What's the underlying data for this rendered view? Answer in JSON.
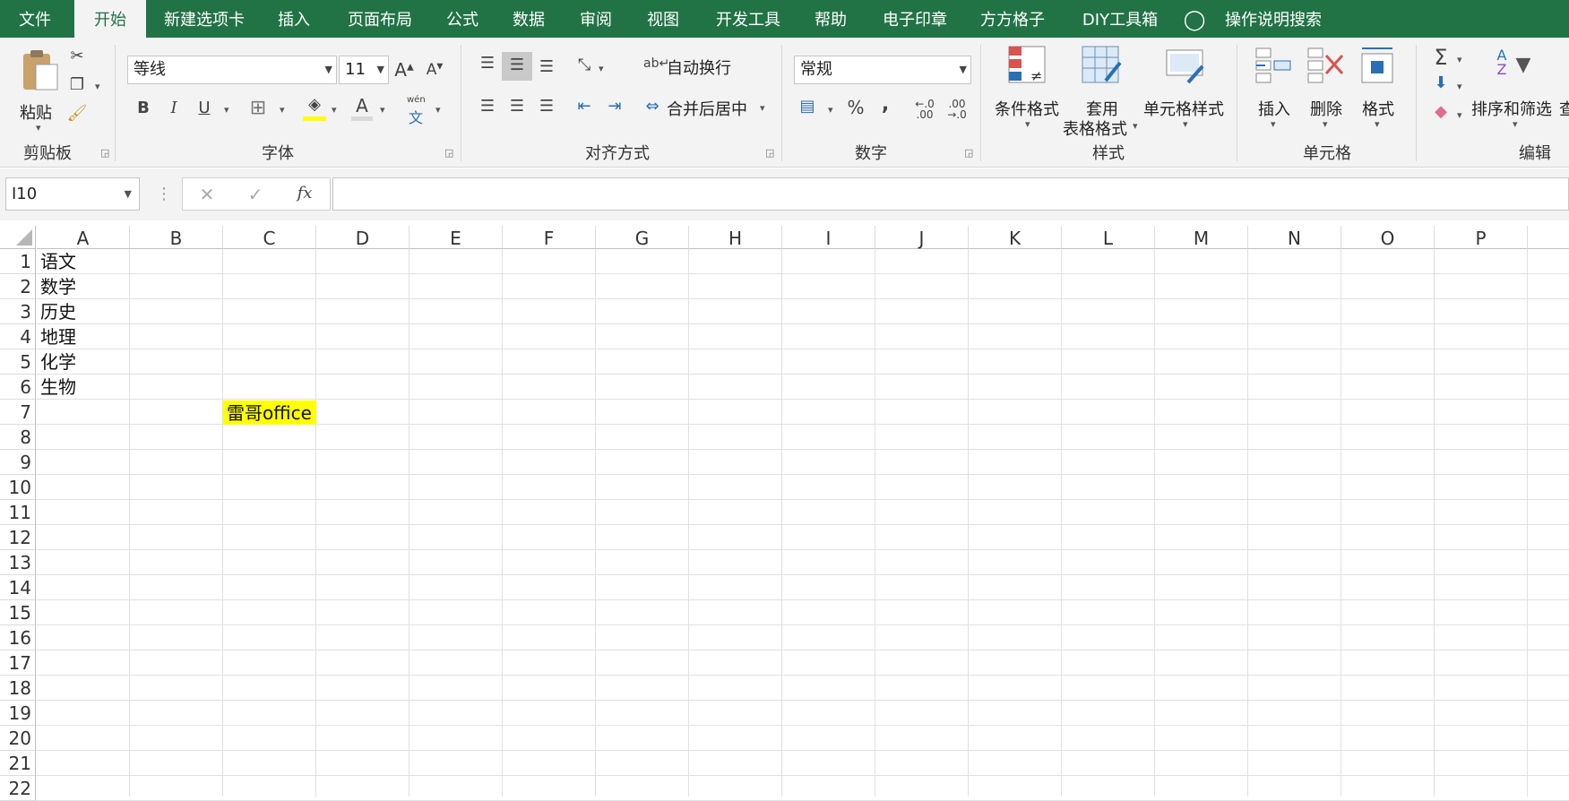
{
  "ribbon_tabs": [
    "文件",
    "开始",
    "新建选项卡",
    "插入",
    "页面布局",
    "公式",
    "数据",
    "审阅",
    "视图",
    "开发工具",
    "帮助",
    "电子印章",
    "方方格子",
    "DIY工具箱"
  ],
  "active_tab": "开始",
  "tell_me": "操作说明搜索",
  "clipboard": {
    "paste": "粘贴",
    "group": "剪贴板"
  },
  "font": {
    "name": "等线",
    "size": "11",
    "bold": "B",
    "italic": "I",
    "underline": "U",
    "phonetic_top": "wén",
    "phonetic_bottom": "文",
    "group": "字体"
  },
  "alignment": {
    "wrap": "自动换行",
    "merge": "合并后居中",
    "group": "对齐方式"
  },
  "number": {
    "format": "常规",
    "percent": "%",
    "comma": ",",
    "inc_decimal": "←.0 .00",
    "dec_decimal": ".00 →.0",
    "group": "数字"
  },
  "styles": {
    "conditional": "条件格式",
    "table_line1": "套用",
    "table_line2": "表格格式",
    "cell_styles": "单元格样式",
    "group": "样式"
  },
  "cells": {
    "insert": "插入",
    "delete": "删除",
    "format": "格式",
    "group": "单元格"
  },
  "editing": {
    "sort_filter": "排序和筛选",
    "find_partial": "查",
    "group": "编辑"
  },
  "name_box": "I10",
  "formula_value": "",
  "fx_label": "fx",
  "columns": [
    "A",
    "B",
    "C",
    "D",
    "E",
    "F",
    "G",
    "H",
    "I",
    "J",
    "K",
    "L",
    "M",
    "N",
    "O",
    "P"
  ],
  "rows": [
    "1",
    "2",
    "3",
    "4",
    "5",
    "6",
    "7",
    "8",
    "9",
    "10",
    "11",
    "12",
    "13",
    "14",
    "15",
    "16",
    "17",
    "18",
    "19",
    "20",
    "21",
    "22"
  ],
  "cells_data": {
    "A1": "语文",
    "A2": "数学",
    "A3": "历史",
    "A4": "地理",
    "A5": "化学",
    "A6": "生物",
    "C7": "雷哥office"
  },
  "colors": {
    "accent": "#217346",
    "highlight": "#ffff00"
  }
}
